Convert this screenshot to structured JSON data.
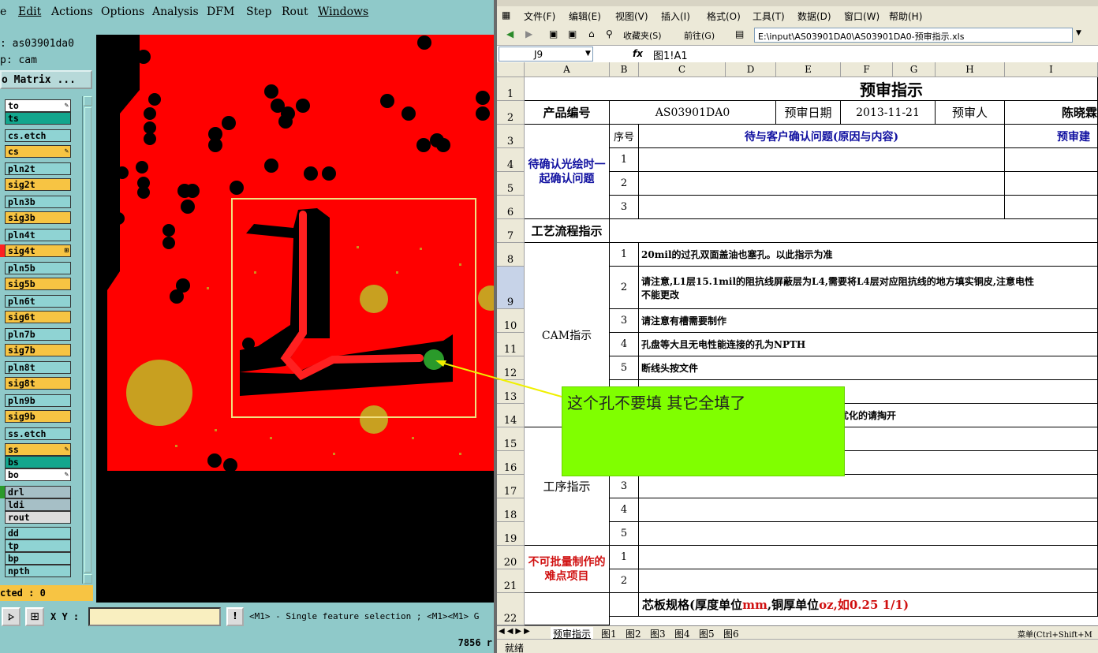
{
  "cam": {
    "menu": [
      "e",
      "Edit",
      "Actions",
      "Options",
      "Analysis",
      "DFM",
      "Step",
      "Rout",
      "Windows"
    ],
    "job_label": ": as03901da0",
    "step_label": "p: cam",
    "matrix_button": "o Matrix ...",
    "layers": [
      {
        "name": "to",
        "color": "#ffffff",
        "icon": "pen"
      },
      {
        "name": "ts",
        "color": "#13a68d"
      },
      {
        "name": "cs.etch",
        "color": "#8fd3d3"
      },
      {
        "name": "cs",
        "color": "#f7c443",
        "icon": "pen"
      },
      {
        "name": "pln2t",
        "color": "#8fd3d3"
      },
      {
        "name": "sig2t",
        "color": "#f7c443"
      },
      {
        "name": "pln3b",
        "color": "#8fd3d3"
      },
      {
        "name": "sig3b",
        "color": "#f7c443"
      },
      {
        "name": "pln4t",
        "color": "#8fd3d3"
      },
      {
        "name": "sig4t",
        "color": "#f7c443",
        "icon": "grid",
        "marker": "#ff2020"
      },
      {
        "name": "pln5b",
        "color": "#8fd3d3"
      },
      {
        "name": "sig5b",
        "color": "#f7c443"
      },
      {
        "name": "pln6t",
        "color": "#8fd3d3"
      },
      {
        "name": "sig6t",
        "color": "#f7c443"
      },
      {
        "name": "pln7b",
        "color": "#8fd3d3"
      },
      {
        "name": "sig7b",
        "color": "#f7c443"
      },
      {
        "name": "pln8t",
        "color": "#8fd3d3"
      },
      {
        "name": "sig8t",
        "color": "#f7c443"
      },
      {
        "name": "pln9b",
        "color": "#8fd3d3"
      },
      {
        "name": "sig9b",
        "color": "#f7c443"
      },
      {
        "name": "ss.etch",
        "color": "#8fd3d3"
      },
      {
        "name": "ss",
        "color": "#f7c443",
        "icon": "pen"
      },
      {
        "name": "bs",
        "color": "#13a68d"
      },
      {
        "name": "bo",
        "color": "#ffffff",
        "icon": "pen"
      },
      {
        "name": "drl",
        "color": "#a6bfc6",
        "marker": "#2a9a2a"
      },
      {
        "name": "ldi",
        "color": "#a6bfc6"
      },
      {
        "name": "rout",
        "color": "#dcdcdc"
      },
      {
        "name": "dd",
        "color": "#8fd3d3"
      },
      {
        "name": "tp",
        "color": "#8fd3d3"
      },
      {
        "name": "bp",
        "color": "#8fd3d3"
      },
      {
        "name": "npth",
        "color": "#8fd3d3"
      }
    ],
    "selected_label": "cted : 0",
    "xy_label": "X Y :",
    "alert_button": "!",
    "hint": "<M1> - Single feature selection ; <M1><M1> G",
    "coord": "7856 r",
    "colors": {
      "board": "#ff0000",
      "copper_void": "#000000",
      "pad": "#c8a020",
      "hole": "#2a9a2a",
      "highlight": "#f0e080"
    }
  },
  "excel": {
    "menu": [
      "文件(F)",
      "编辑(E)",
      "视图(V)",
      "插入(I)",
      "格式(O)",
      "工具(T)",
      "数据(D)",
      "窗口(W)",
      "帮助(H)"
    ],
    "favorites": "收藏夹(S)",
    "goto": "前往(G)",
    "address": "E:\\input\\AS03901DA0\\AS03901DA0-预审指示.xls",
    "name_box": "J9",
    "fx": "fx",
    "formula": "图1!A1",
    "columns": [
      "A",
      "B",
      "C",
      "D",
      "E",
      "F",
      "G",
      "H",
      "I"
    ],
    "rows": [
      "1",
      "2",
      "3",
      "4",
      "5",
      "6",
      "7",
      "8",
      "9",
      "10",
      "11",
      "12",
      "13",
      "14",
      "15",
      "16",
      "17",
      "18",
      "19",
      "20",
      "21",
      "22"
    ],
    "title": "预审指示",
    "product_label": "产品编号",
    "product_value": "AS03901DA0",
    "date_label": "预审日期",
    "date_value": "2013-11-21",
    "reviewer_label": "预审人",
    "reviewer_value": "陈晓霖",
    "seq_header": "序号",
    "question_header": "待与客户确认问题(原因与内容)",
    "suggest_header": "预审建",
    "confirm_label": "待确认光绘时一起确认问题",
    "flow_label": "工艺流程指示",
    "cam_label": "CAM指示",
    "process_label": "工序指示",
    "difficulty_label": "不可批量制作的难点项目",
    "nums": [
      "1",
      "2",
      "3",
      "1",
      "2",
      "3",
      "4",
      "5",
      "3",
      "4",
      "5",
      "1",
      "2"
    ],
    "cam_items": [
      "20mil的过孔双面盖油也塞孔。以此指示为准",
      "请注意,L1层15.1mil的阻抗线屏蔽层为L4,需要将L4层对应阻抗线的地方填实铜皮,注意电性",
      "不能更改",
      "请注意有槽需要制作",
      "孔盘等大且无电性能连接的孔为NPTH",
      "断线头按文件",
      "无法优化的请掏开"
    ],
    "core_spec_a": "芯板规格(厚度单位",
    "core_spec_mm": "mm",
    "core_spec_b": ",铜厚单位",
    "core_spec_oz": "oz",
    "core_spec_c": ",如0.25 1/1)",
    "sheet_tabs": [
      "预审指示",
      "图1",
      "图2",
      "图3",
      "图4",
      "图5",
      "图6"
    ],
    "shortcut_hint": "菜单(Ctrl+Shift+M",
    "status": "就绪"
  },
  "callout": "这个孔不要填 其它全填了"
}
